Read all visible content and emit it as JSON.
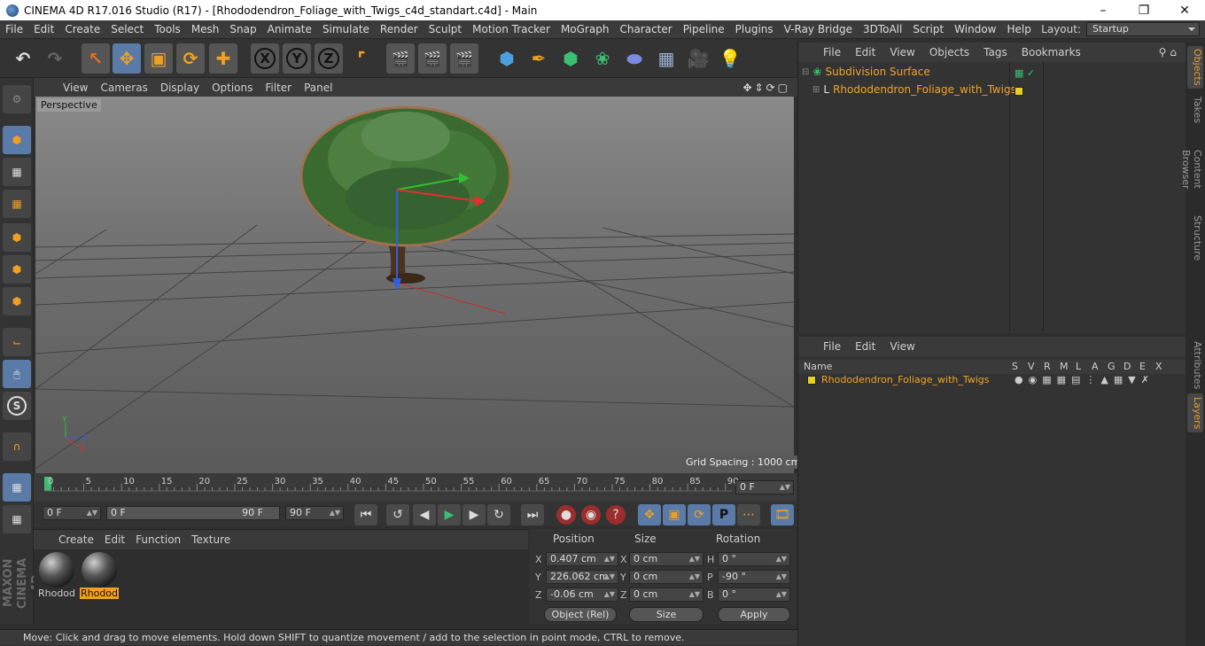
{
  "window": {
    "title": "CINEMA 4D R17.016 Studio (R17) - [Rhododendron_Foliage_with_Twigs_c4d_standart.c4d] - Main"
  },
  "menu": [
    "File",
    "Edit",
    "Create",
    "Select",
    "Tools",
    "Mesh",
    "Snap",
    "Animate",
    "Simulate",
    "Render",
    "Sculpt",
    "Motion Tracker",
    "MoGraph",
    "Character",
    "Pipeline",
    "Plugins",
    "V-Ray Bridge",
    "3DToAll",
    "Script",
    "Window",
    "Help"
  ],
  "layout": {
    "label": "Layout:",
    "value": "Startup"
  },
  "viewport": {
    "menu": [
      "View",
      "Cameras",
      "Display",
      "Options",
      "Filter",
      "Panel"
    ],
    "label": "Perspective",
    "grid_spacing": "Grid Spacing : 1000 cm"
  },
  "timeline": {
    "ticks": [
      "0",
      "5",
      "10",
      "15",
      "20",
      "25",
      "30",
      "35",
      "40",
      "45",
      "50",
      "55",
      "60",
      "65",
      "70",
      "75",
      "80",
      "85",
      "90"
    ],
    "current_frame": "0 F",
    "start": "0 F",
    "range_start": "0 F",
    "range_end": "90 F",
    "end": "90 F"
  },
  "materials": {
    "menu": [
      "Create",
      "Edit",
      "Function",
      "Texture"
    ],
    "items": [
      {
        "name": "Rhodod"
      },
      {
        "name": "Rhodod"
      }
    ]
  },
  "coords": {
    "headers": {
      "position": "Position",
      "size": "Size",
      "rotation": "Rotation"
    },
    "rows": [
      {
        "axis": "X",
        "pos": "0.407 cm",
        "size_axis": "X",
        "size": "0 cm",
        "rot_axis": "H",
        "rot": "0 °"
      },
      {
        "axis": "Y",
        "pos": "226.062 cm",
        "size_axis": "Y",
        "size": "0 cm",
        "rot_axis": "P",
        "rot": "-90 °"
      },
      {
        "axis": "Z",
        "pos": "-0.06 cm",
        "size_axis": "Z",
        "size": "0 cm",
        "rot_axis": "B",
        "rot": "0 °"
      }
    ],
    "mode": "Object (Rel)",
    "size_mode": "Size",
    "apply": "Apply"
  },
  "status": "Move: Click and drag to move elements. Hold down SHIFT to quantize movement / add to the selection in point mode, CTRL to remove.",
  "objects": {
    "menu": [
      "File",
      "Edit",
      "View",
      "Objects",
      "Tags",
      "Bookmarks"
    ],
    "items": [
      {
        "name": "Subdivision Surface"
      },
      {
        "name": "Rhododendron_Foliage_with_Twigs"
      }
    ]
  },
  "layers": {
    "menu": [
      "File",
      "Edit",
      "View"
    ],
    "columns": {
      "name": "Name",
      "flags": [
        "S",
        "V",
        "R",
        "M",
        "L",
        "A",
        "G",
        "D",
        "E",
        "X"
      ]
    },
    "items": [
      {
        "name": "Rhododendron_Foliage_with_Twigs"
      }
    ]
  },
  "right_tabs": [
    "Objects",
    "Takes",
    "Content Browser",
    "Structure",
    "Attributes",
    "Layers"
  ],
  "brand": "MAXON CINEMA 4D"
}
